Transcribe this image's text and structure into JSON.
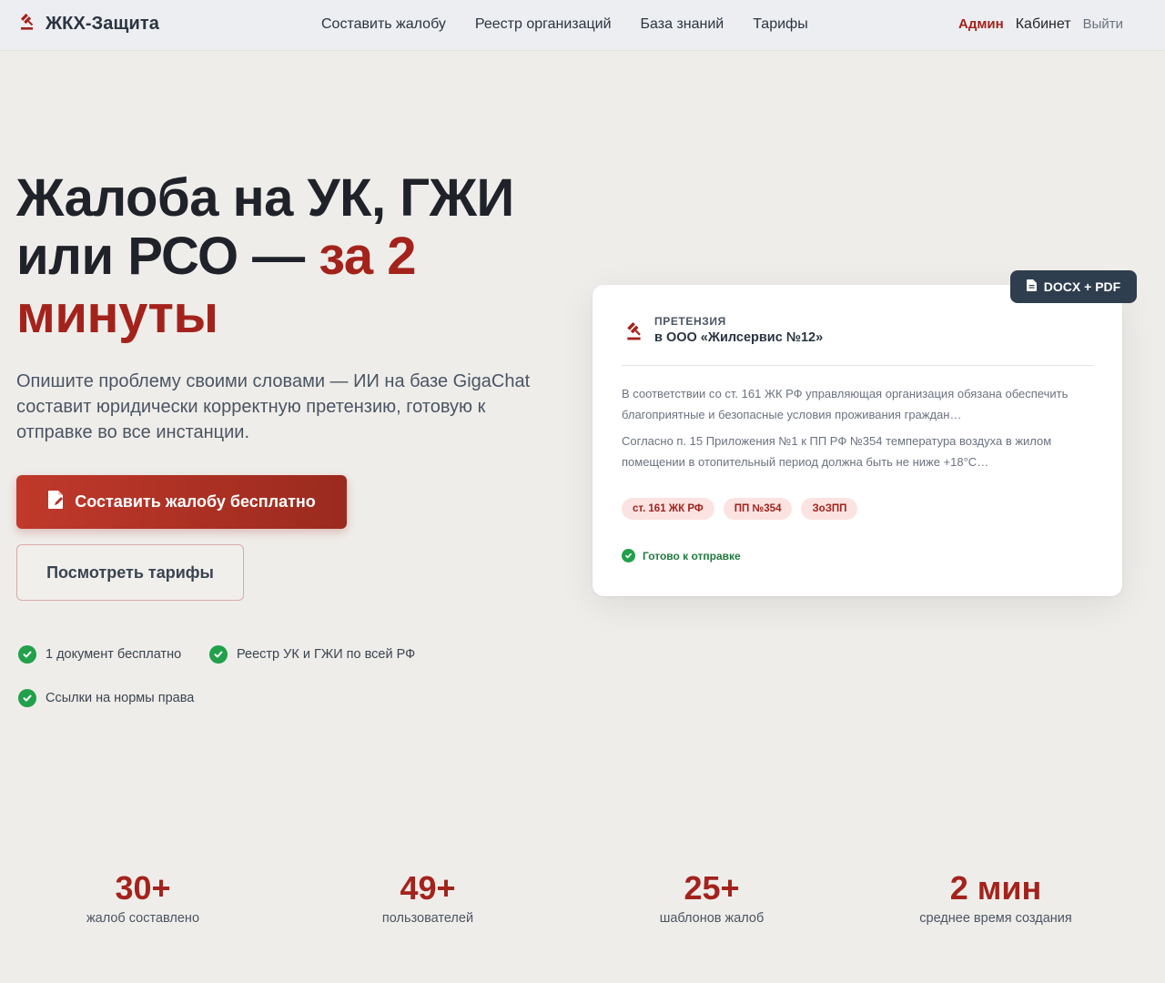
{
  "header": {
    "logo_text": "ЖКХ-Защита",
    "nav": [
      "Составить жалобу",
      "Реестр организаций",
      "База знаний",
      "Тарифы"
    ],
    "admin_label": "Админ",
    "cabinet_label": "Кабинет",
    "logout_label": "Выйти"
  },
  "hero": {
    "title_line1": "Жалоба на УК, ГЖИ",
    "title_line2": "или РСО — ",
    "title_accent_a": "за 2",
    "title_accent_b": "минуты",
    "subtitle": "Опишите проблему своими словами — ИИ на базе GigaChat составит юридически корректную претензию, готовую к отправке во все инстанции.",
    "primary_cta": "Составить жалобу бесплатно",
    "secondary_cta": "Посмотреть тарифы",
    "features": [
      "1 документ бесплатно",
      "Реестр УК и ГЖИ по всей РФ",
      "Ссылки на нормы права"
    ]
  },
  "card": {
    "badge": "DOCX + PDF",
    "type": "ПРЕТЕНЗИЯ",
    "org": "в ООО «Жилсервис №12»",
    "p1": "В соответствии со ст. 161 ЖК РФ управляющая организация обязана обеспечить благоприятные и безопасные условия проживания граждан…",
    "p2": "Согласно п. 15 Приложения №1 к ПП РФ №354 температура воздуха в жилом помещении в отопительный период должна быть не ниже +18°C…",
    "tags": [
      "ст. 161 ЖК РФ",
      "ПП №354",
      "ЗоЗПП"
    ],
    "status": "Готово к отправке"
  },
  "stats": [
    {
      "value": "30+",
      "label": "жалоб составлено"
    },
    {
      "value": "49+",
      "label": "пользователей"
    },
    {
      "value": "25+",
      "label": "шаблонов жалоб"
    },
    {
      "value": "2 мин",
      "label": "среднее время создания"
    }
  ],
  "colors": {
    "accent": "#a3231c",
    "success": "#22a04b",
    "badge": "#2f3e4e"
  }
}
